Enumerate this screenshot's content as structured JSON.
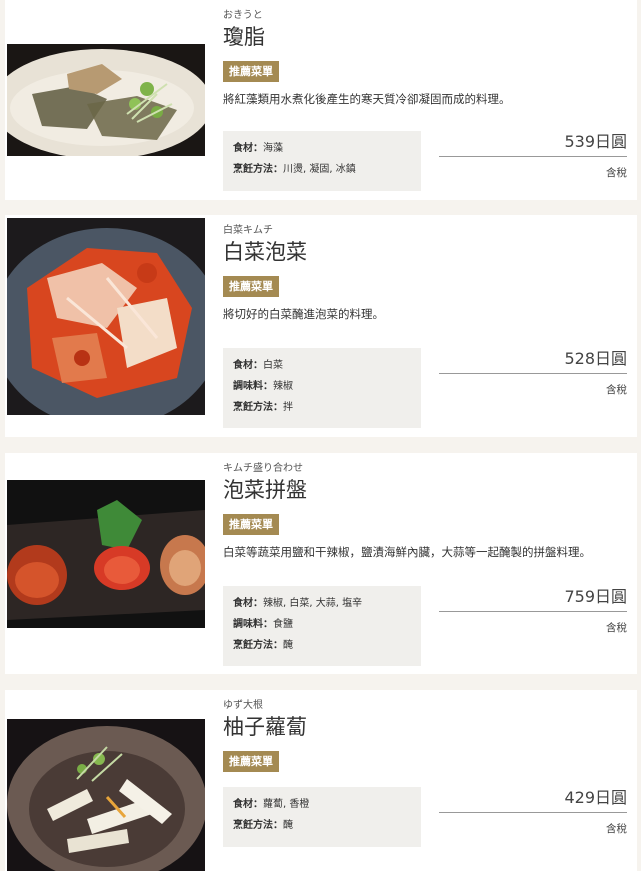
{
  "badge_label": "推薦菜單",
  "items": [
    {
      "reading": "おきうと",
      "name": "瓊脂",
      "desc": "將紅藻類用水煮化後產生的寒天質冷卻凝固而成的料理。",
      "specs": [
        {
          "key": "食材：",
          "value": "海藻"
        },
        {
          "key": "烹飪方法：",
          "value": "川燙, 凝固, 冰鎮"
        }
      ],
      "price": "539日圓",
      "tax": "含稅"
    },
    {
      "reading": "白菜キムチ",
      "name": "白菜泡菜",
      "desc": "將切好的白菜醃進泡菜的料理。",
      "specs": [
        {
          "key": "食材：",
          "value": "白菜"
        },
        {
          "key": "調味料：",
          "value": "辣椒"
        },
        {
          "key": "烹飪方法：",
          "value": "拌"
        }
      ],
      "price": "528日圓",
      "tax": "含稅"
    },
    {
      "reading": "キムチ盛り合わせ",
      "name": "泡菜拼盤",
      "desc": "白菜等蔬菜用鹽和干辣椒，鹽漬海鮮內臟，大蒜等一起醃製的拼盤料理。",
      "specs": [
        {
          "key": "食材：",
          "value": "辣椒, 白菜, 大蒜, 塩辛"
        },
        {
          "key": "調味料：",
          "value": "食鹽"
        },
        {
          "key": "烹飪方法：",
          "value": "醃"
        }
      ],
      "price": "759日圓",
      "tax": "含稅"
    },
    {
      "reading": "ゆず大根",
      "name": "柚子蘿蔔",
      "desc": "",
      "specs": [
        {
          "key": "食材：",
          "value": "蘿蔔, 香橙"
        },
        {
          "key": "烹飪方法：",
          "value": "醃"
        }
      ],
      "price": "429日圓",
      "tax": "含稅"
    }
  ]
}
